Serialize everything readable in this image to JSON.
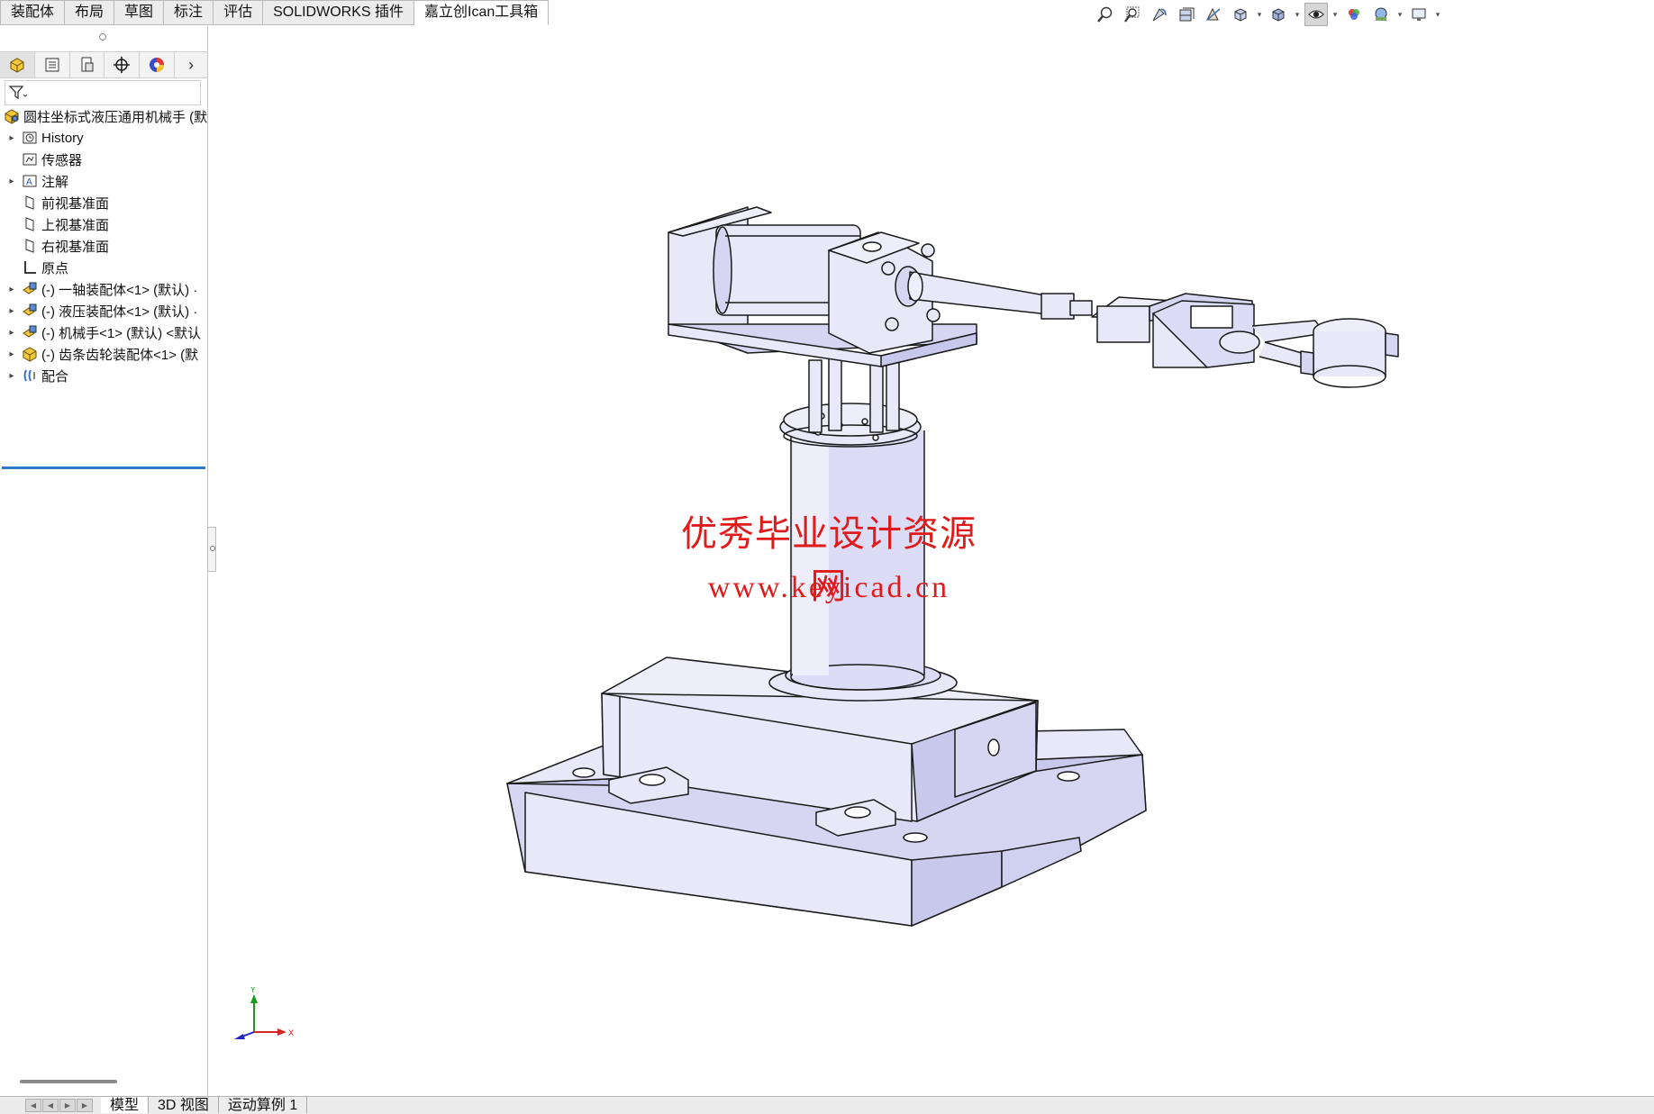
{
  "command_tabs": [
    {
      "label": "装配体",
      "active": false
    },
    {
      "label": "布局",
      "active": false
    },
    {
      "label": "草图",
      "active": false
    },
    {
      "label": "标注",
      "active": false
    },
    {
      "label": "评估",
      "active": false
    },
    {
      "label": "SOLIDWORKS 插件",
      "active": false
    },
    {
      "label": "嘉立创Ican工具箱",
      "active": true
    }
  ],
  "heads_up_toolbar": [
    "zoom-to-fit-icon",
    "zoom-to-area-icon",
    "previous-view-icon",
    "section-view-icon",
    "dynamic-annotation-icon",
    "view-orientation-icon",
    "display-style-icon",
    "hide-show-items-icon",
    "edit-appearance-icon",
    "apply-scene-icon",
    "view-settings-icon"
  ],
  "feature_manager": {
    "panel_tabs": [
      "featuremanager-icon",
      "propertymanager-icon",
      "configurationmanager-icon",
      "dimxpert-icon",
      "displaymanager-icon"
    ],
    "tree": [
      {
        "label": "圆柱坐标式液压通用机械手 (默",
        "icon": "assembly-icon",
        "expander": "",
        "root": true
      },
      {
        "label": "History",
        "icon": "history-folder-icon",
        "expander": "▸"
      },
      {
        "label": "传感器",
        "icon": "sensor-folder-icon",
        "expander": ""
      },
      {
        "label": "注解",
        "icon": "annotation-folder-icon",
        "expander": "▸"
      },
      {
        "label": "前视基准面",
        "icon": "plane-icon",
        "expander": ""
      },
      {
        "label": "上视基准面",
        "icon": "plane-icon",
        "expander": ""
      },
      {
        "label": "右视基准面",
        "icon": "plane-icon",
        "expander": ""
      },
      {
        "label": "原点",
        "icon": "origin-icon",
        "expander": ""
      },
      {
        "label": "(-) 一轴装配体<1> (默认) ·",
        "icon": "subassembly-icon",
        "expander": "▸"
      },
      {
        "label": "(-) 液压装配体<1> (默认) ·",
        "icon": "subassembly-icon",
        "expander": "▸"
      },
      {
        "label": "(-) 机械手<1> (默认) <默认",
        "icon": "subassembly-icon",
        "expander": "▸"
      },
      {
        "label": "(-) 齿条齿轮装配体<1> (默",
        "icon": "assembly-icon",
        "expander": "▸"
      },
      {
        "label": "配合",
        "icon": "mates-icon",
        "expander": "▸"
      }
    ]
  },
  "watermark": {
    "line1": "优秀毕业设计资源网",
    "line2": "www.keyicad.cn"
  },
  "triad": {
    "x": "X",
    "y": "Y"
  },
  "bottom_tabs": [
    {
      "label": "模型",
      "active": true
    },
    {
      "label": "3D 视图",
      "active": false
    },
    {
      "label": "运动算例 1",
      "active": false
    }
  ],
  "colors": {
    "part_fill": "#e8e8f8",
    "part_shade": "#c8c8ec",
    "edge": "#1a1a1a",
    "watermark": "#e01b1b",
    "selection_line": "#2f79c6"
  }
}
